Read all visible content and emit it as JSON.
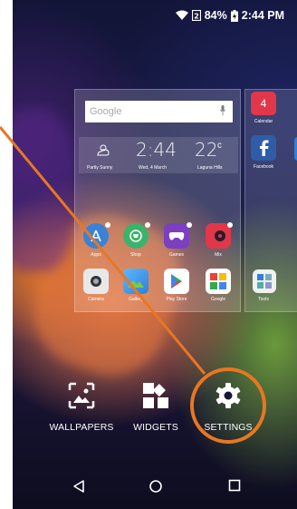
{
  "status_bar": {
    "battery_percent": "84%",
    "time": "2:44 PM"
  },
  "search_widget": {
    "placeholder": "Google"
  },
  "weather_widget": {
    "time": "2:44",
    "temperature": "22",
    "temperature_unit": "c",
    "condition": "Partly Sunny",
    "date": "Wed, 4 March",
    "location": "Laguna Hills"
  },
  "apps_row1": [
    {
      "label": "Apps",
      "color": "#3b82d6",
      "icon": "apps-icon"
    },
    {
      "label": "Shop",
      "color": "#3bb36b",
      "icon": "shop-icon"
    },
    {
      "label": "Games",
      "color": "#7b3fbf",
      "icon": "games-icon"
    },
    {
      "label": "Mix",
      "color": "#e0384a",
      "icon": "mix-icon"
    }
  ],
  "apps_row2": [
    {
      "label": "Camera",
      "color": "#e8e8e8",
      "icon": "camera-icon"
    },
    {
      "label": "Gallery",
      "color": "#4aa4e0",
      "icon": "gallery-icon"
    },
    {
      "label": "Play Store",
      "color": "#ffffff",
      "icon": "play-store-icon"
    },
    {
      "label": "Google",
      "color": "#ffffff",
      "icon": "google-folder-icon"
    }
  ],
  "side_page_apps": [
    {
      "label": "Calendar",
      "color": "#e0384a",
      "icon": "calendar-icon",
      "value": "4"
    },
    {
      "label": "Facebook",
      "color": "#2f5ca8",
      "icon": "facebook-icon"
    },
    {
      "label": "Tools",
      "color": "#ffffff",
      "icon": "tools-folder-icon"
    }
  ],
  "dock": {
    "wallpapers": "WALLPAPERS",
    "widgets": "WIDGETS",
    "settings": "SETTINGS"
  },
  "colors": {
    "annotation": "#e87722"
  }
}
